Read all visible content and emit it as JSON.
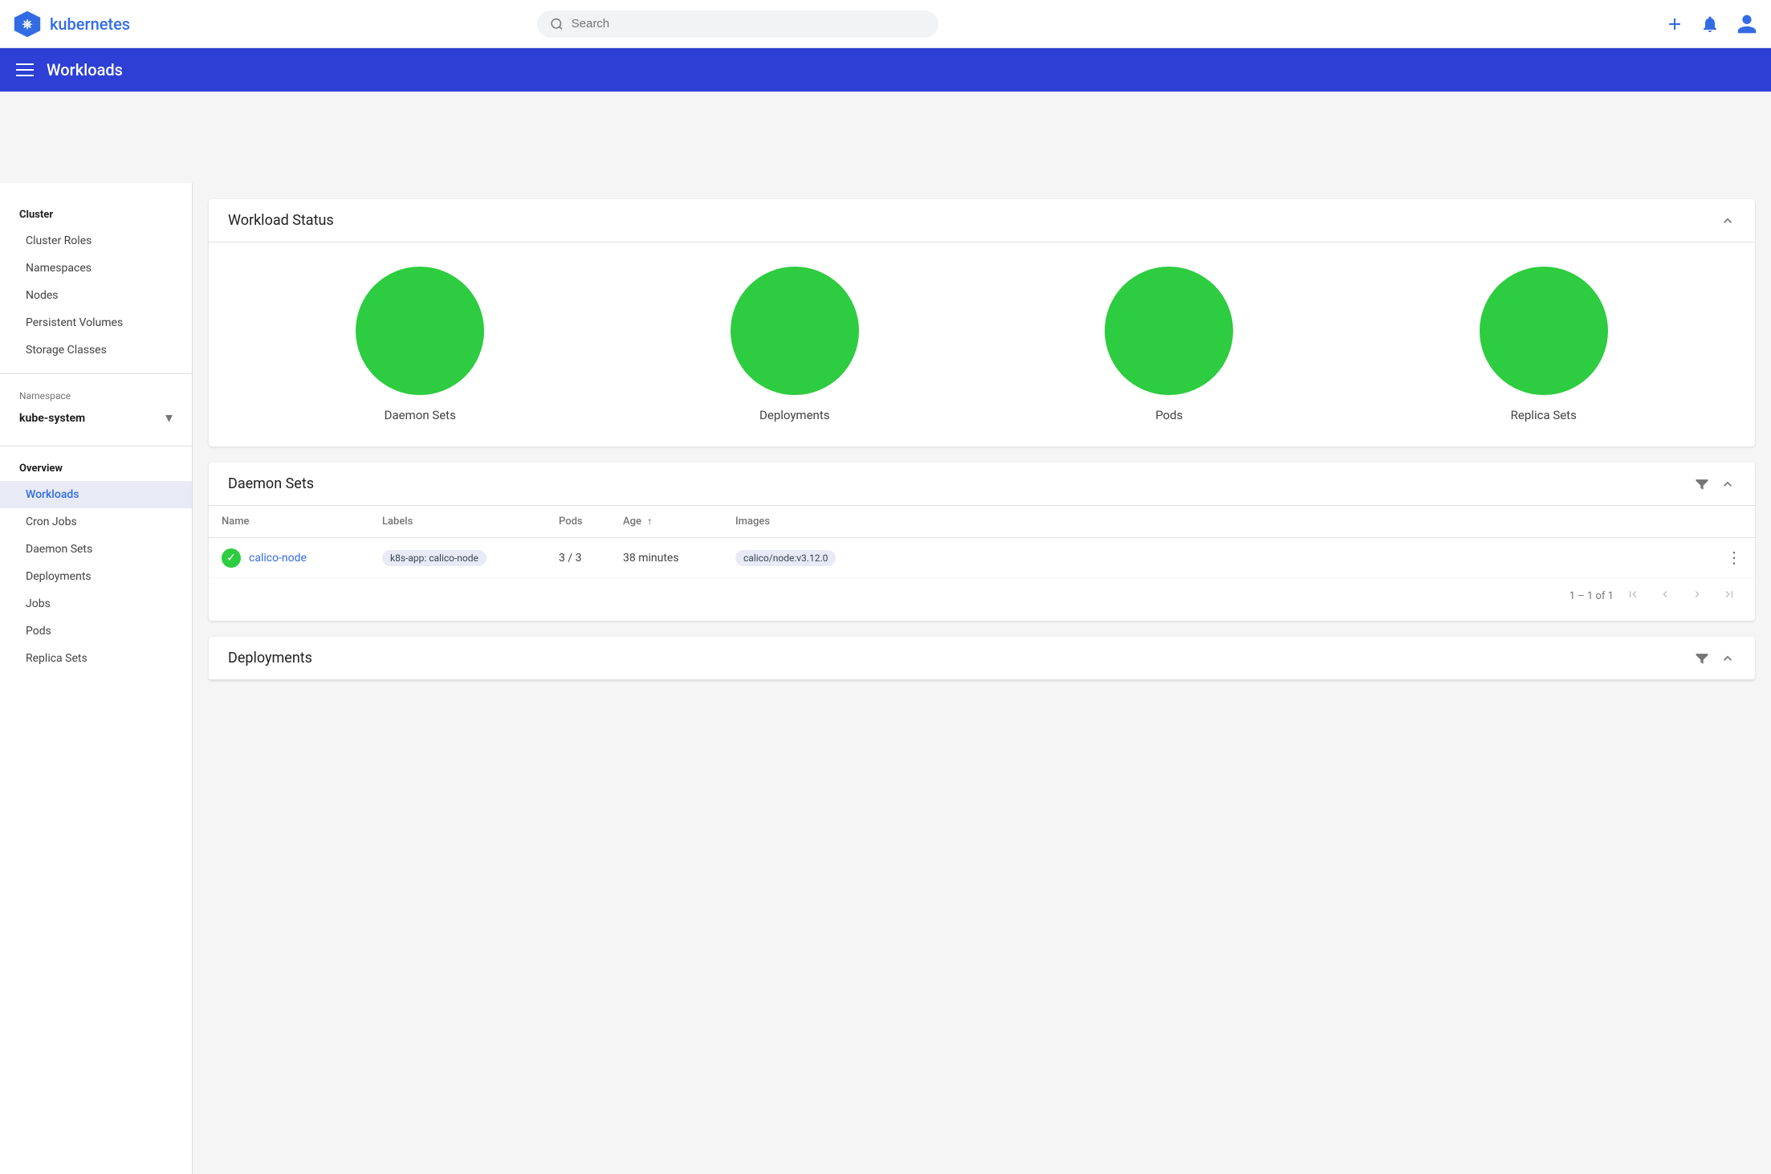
{
  "topbar": {
    "logo_text": "kubernetes",
    "search_placeholder": "Search",
    "add_btn_label": "+",
    "notification_label": "🔔",
    "user_label": "👤"
  },
  "page_header": {
    "title": "Workloads"
  },
  "sidebar": {
    "cluster_section": "Cluster",
    "cluster_items": [
      {
        "label": "Cluster Roles",
        "id": "cluster-roles"
      },
      {
        "label": "Namespaces",
        "id": "namespaces"
      },
      {
        "label": "Nodes",
        "id": "nodes"
      },
      {
        "label": "Persistent Volumes",
        "id": "persistent-volumes"
      },
      {
        "label": "Storage Classes",
        "id": "storage-classes"
      }
    ],
    "namespace_label": "Namespace",
    "namespace_value": "kube-system",
    "overview_label": "Overview",
    "overview_items": [
      {
        "label": "Workloads",
        "id": "workloads",
        "active": true
      },
      {
        "label": "Cron Jobs",
        "id": "cron-jobs"
      },
      {
        "label": "Daemon Sets",
        "id": "daemon-sets"
      },
      {
        "label": "Deployments",
        "id": "deployments"
      },
      {
        "label": "Jobs",
        "id": "jobs"
      },
      {
        "label": "Pods",
        "id": "pods"
      },
      {
        "label": "Replica Sets",
        "id": "replica-sets"
      }
    ]
  },
  "workload_status": {
    "title": "Workload Status",
    "circles": [
      {
        "label": "Daemon Sets"
      },
      {
        "label": "Deployments"
      },
      {
        "label": "Pods"
      },
      {
        "label": "Replica Sets"
      }
    ]
  },
  "daemon_sets": {
    "title": "Daemon Sets",
    "columns": [
      {
        "key": "name",
        "label": "Name"
      },
      {
        "key": "labels",
        "label": "Labels"
      },
      {
        "key": "pods",
        "label": "Pods"
      },
      {
        "key": "age",
        "label": "Age",
        "sort": true
      },
      {
        "key": "images",
        "label": "Images"
      }
    ],
    "rows": [
      {
        "name": "calico-node",
        "labels": "k8s-app: calico-node",
        "pods": "3 / 3",
        "age": "38 minutes",
        "images": "calico/node:v3.12.0"
      }
    ],
    "pagination": "1 – 1 of 1"
  },
  "deployments": {
    "title": "Deployments"
  }
}
